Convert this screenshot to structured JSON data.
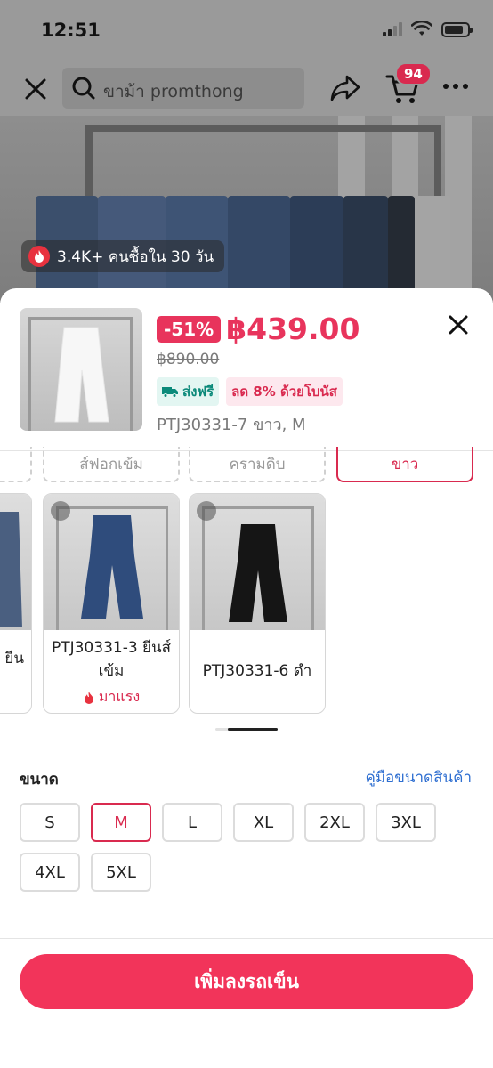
{
  "status_bar": {
    "time": "12:51"
  },
  "nav": {
    "search_placeholder": "ขาม้า promthong",
    "cart_count": "94"
  },
  "hero": {
    "sold_text": "3.4K+ คนซื้อใน 30 วัน"
  },
  "product": {
    "discount": "-51%",
    "price": "฿439.00",
    "original_price": "฿890.00",
    "tag_shipping": "ส่งฟรี",
    "tag_bonus": "ลด 8% ด้วยโบนัส",
    "selected_variant": "PTJ30331-7 ขาว, M"
  },
  "color_chips": [
    "",
    "ส์ฟอกเข้ม",
    "ครามดิบ",
    "ขาว"
  ],
  "variant_cards": [
    {
      "title": "ยีน",
      "hot": ""
    },
    {
      "title": "PTJ30331-3 ยีนส์เข้ม",
      "hot": "มาแรง"
    },
    {
      "title": "PTJ30331-6 ดำ",
      "hot": ""
    }
  ],
  "size_section": {
    "label": "ขนาด",
    "guide_link": "คู่มือขนาดสินค้า",
    "options": [
      "S",
      "M",
      "L",
      "XL",
      "2XL",
      "3XL",
      "4XL",
      "5XL"
    ],
    "selected": "M"
  },
  "cta": {
    "add_to_cart": "เพิ่มลงรถเข็น"
  },
  "colors": {
    "accent": "#f2345a",
    "discount": "#e8345c",
    "link": "#2f6fd1",
    "ship_tag": "#0b8a7a"
  }
}
